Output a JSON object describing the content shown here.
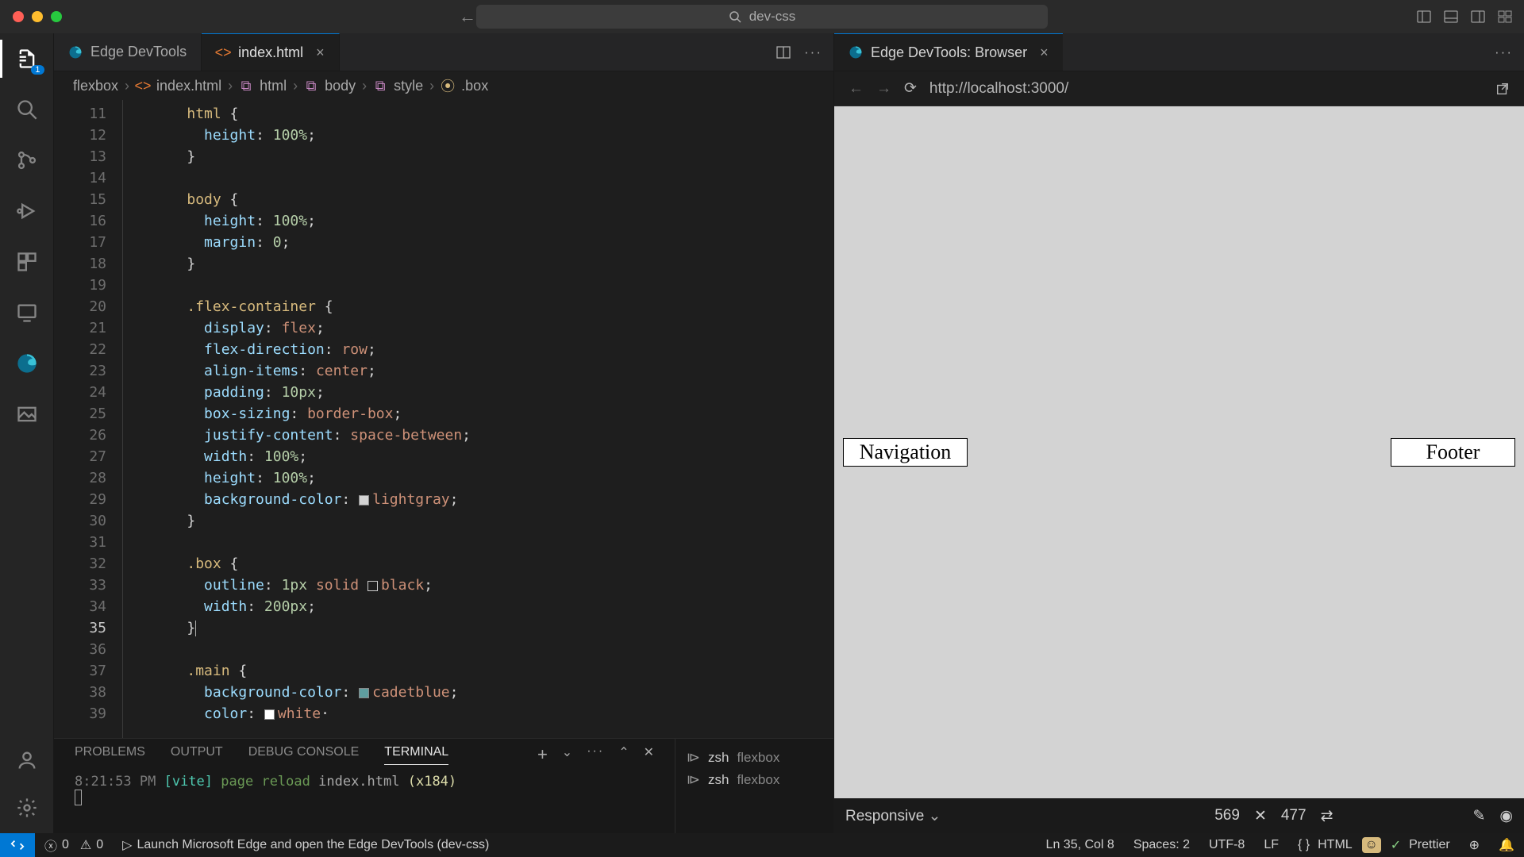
{
  "titlebar": {
    "search": "dev-css"
  },
  "tabs": {
    "left": [
      {
        "label": "Edge DevTools",
        "active": false,
        "icon": "edge"
      },
      {
        "label": "index.html",
        "active": true,
        "icon": "html",
        "close": "×"
      }
    ],
    "preview": {
      "label": "Edge DevTools: Browser",
      "close": "×"
    }
  },
  "breadcrumb": [
    "flexbox",
    "index.html",
    "html",
    "body",
    "style",
    ".box"
  ],
  "gutter": {
    "start": 11,
    "end": 39,
    "current": 35
  },
  "code": {
    "lines": [
      {
        "t": "sel_open",
        "sel": "html"
      },
      {
        "t": "decl",
        "prop": "height",
        "val": "100%",
        "cls": "num"
      },
      {
        "t": "close"
      },
      {
        "t": "blank"
      },
      {
        "t": "sel_open",
        "sel": "body"
      },
      {
        "t": "decl",
        "prop": "height",
        "val": "100%",
        "cls": "num"
      },
      {
        "t": "decl",
        "prop": "margin",
        "val": "0",
        "cls": "num"
      },
      {
        "t": "close"
      },
      {
        "t": "blank"
      },
      {
        "t": "sel_open",
        "sel": ".flex-container"
      },
      {
        "t": "decl",
        "prop": "display",
        "val": "flex",
        "cls": "val"
      },
      {
        "t": "decl",
        "prop": "flex-direction",
        "val": "row",
        "cls": "val"
      },
      {
        "t": "decl",
        "prop": "align-items",
        "val": "center",
        "cls": "val"
      },
      {
        "t": "decl",
        "prop": "padding",
        "val": "10px",
        "cls": "num"
      },
      {
        "t": "decl",
        "prop": "box-sizing",
        "val": "border-box",
        "cls": "val"
      },
      {
        "t": "decl",
        "prop": "justify-content",
        "val": "space-between",
        "cls": "val"
      },
      {
        "t": "decl",
        "prop": "width",
        "val": "100%",
        "cls": "num"
      },
      {
        "t": "decl",
        "prop": "height",
        "val": "100%",
        "cls": "num"
      },
      {
        "t": "decl_sw",
        "prop": "background-color",
        "val": "lightgray",
        "color": "#d3d3d3"
      },
      {
        "t": "close"
      },
      {
        "t": "blank"
      },
      {
        "t": "sel_open",
        "sel": ".box"
      },
      {
        "t": "decl_sw_outline",
        "prop": "outline",
        "pre": "1px",
        "kw": "solid",
        "val": "black",
        "color": "transparent"
      },
      {
        "t": "decl",
        "prop": "width",
        "val": "200px",
        "cls": "num"
      },
      {
        "t": "close_cursor"
      },
      {
        "t": "blank"
      },
      {
        "t": "sel_open",
        "sel": ".main"
      },
      {
        "t": "decl_sw",
        "prop": "background-color",
        "val": "cadetblue",
        "color": "#5f9ea0"
      },
      {
        "t": "decl_sw_partial",
        "prop": "color",
        "val": "white",
        "color": "#ffffff"
      }
    ]
  },
  "preview": {
    "url": "http://localhost:3000/",
    "boxes": [
      "Navigation",
      "Footer"
    ]
  },
  "device": {
    "mode": "Responsive",
    "w": "569",
    "h": "477"
  },
  "panel": {
    "tabs": [
      "PROBLEMS",
      "OUTPUT",
      "DEBUG CONSOLE",
      "TERMINAL"
    ],
    "active": 3,
    "terminal": {
      "time": "8:21:53 PM",
      "tag": "[vite]",
      "msg": "page reload",
      "file": "index.html",
      "count": "(x184)"
    },
    "procs": [
      {
        "shell": "zsh",
        "dir": "flexbox"
      },
      {
        "shell": "zsh",
        "dir": "flexbox"
      }
    ]
  },
  "status": {
    "errors": "0",
    "warnings": "0",
    "launch": "Launch Microsoft Edge and open the Edge DevTools (dev-css)",
    "pos": "Ln 35, Col 8",
    "spaces": "Spaces: 2",
    "enc": "UTF-8",
    "eol": "LF",
    "lang": "HTML",
    "prettier": "Prettier"
  },
  "activity_badge": "1"
}
